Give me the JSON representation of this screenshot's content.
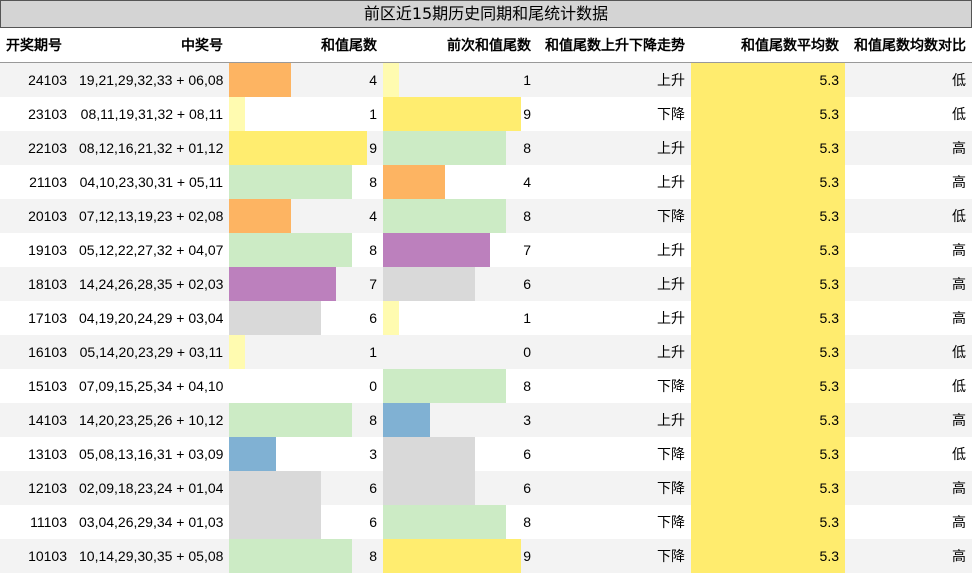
{
  "title": "前区近15期历史同期和尾统计数据",
  "headers": {
    "issue": "开奖期号",
    "numbers": "中奖号",
    "tail": "和值尾数",
    "prev_tail": "前次和值尾数",
    "trend": "和值尾数上升下降走势",
    "avg": "和值尾数平均数",
    "compare": "和值尾数均数对比"
  },
  "colors": {
    "0": "#ffffff",
    "1": "#fffbb0",
    "3": "#80b1d3",
    "4": "#fdb462",
    "6": "#d9d9d9",
    "7": "#bc80bd",
    "8": "#ccebc5",
    "9": "#ffed6f",
    "avg": "#ffec6e"
  },
  "rows": [
    {
      "issue": "24103",
      "numbers": "19,21,29,32,33 + 06,08",
      "tail": 4,
      "prev": 1,
      "trend": "上升",
      "avg": "5.3",
      "cmp": "低"
    },
    {
      "issue": "23103",
      "numbers": "08,11,19,31,32 + 08,11",
      "tail": 1,
      "prev": 9,
      "trend": "下降",
      "avg": "5.3",
      "cmp": "低"
    },
    {
      "issue": "22103",
      "numbers": "08,12,16,21,32 + 01,12",
      "tail": 9,
      "prev": 8,
      "trend": "上升",
      "avg": "5.3",
      "cmp": "高"
    },
    {
      "issue": "21103",
      "numbers": "04,10,23,30,31 + 05,11",
      "tail": 8,
      "prev": 4,
      "trend": "上升",
      "avg": "5.3",
      "cmp": "高"
    },
    {
      "issue": "20103",
      "numbers": "07,12,13,19,23 + 02,08",
      "tail": 4,
      "prev": 8,
      "trend": "下降",
      "avg": "5.3",
      "cmp": "低"
    },
    {
      "issue": "19103",
      "numbers": "05,12,22,27,32 + 04,07",
      "tail": 8,
      "prev": 7,
      "trend": "上升",
      "avg": "5.3",
      "cmp": "高"
    },
    {
      "issue": "18103",
      "numbers": "14,24,26,28,35 + 02,03",
      "tail": 7,
      "prev": 6,
      "trend": "上升",
      "avg": "5.3",
      "cmp": "高"
    },
    {
      "issue": "17103",
      "numbers": "04,19,20,24,29 + 03,04",
      "tail": 6,
      "prev": 1,
      "trend": "上升",
      "avg": "5.3",
      "cmp": "高"
    },
    {
      "issue": "16103",
      "numbers": "05,14,20,23,29 + 03,11",
      "tail": 1,
      "prev": 0,
      "trend": "上升",
      "avg": "5.3",
      "cmp": "低"
    },
    {
      "issue": "15103",
      "numbers": "07,09,15,25,34 + 04,10",
      "tail": 0,
      "prev": 8,
      "trend": "下降",
      "avg": "5.3",
      "cmp": "低"
    },
    {
      "issue": "14103",
      "numbers": "14,20,23,25,26 + 10,12",
      "tail": 8,
      "prev": 3,
      "trend": "上升",
      "avg": "5.3",
      "cmp": "高"
    },
    {
      "issue": "13103",
      "numbers": "05,08,13,16,31 + 03,09",
      "tail": 3,
      "prev": 6,
      "trend": "下降",
      "avg": "5.3",
      "cmp": "低"
    },
    {
      "issue": "12103",
      "numbers": "02,09,18,23,24 + 01,04",
      "tail": 6,
      "prev": 6,
      "trend": "下降",
      "avg": "5.3",
      "cmp": "高"
    },
    {
      "issue": "11103",
      "numbers": "03,04,26,29,34 + 01,03",
      "tail": 6,
      "prev": 8,
      "trend": "下降",
      "avg": "5.3",
      "cmp": "高"
    },
    {
      "issue": "10103",
      "numbers": "10,14,29,30,35 + 05,08",
      "tail": 8,
      "prev": 9,
      "trend": "下降",
      "avg": "5.3",
      "cmp": "高"
    }
  ]
}
